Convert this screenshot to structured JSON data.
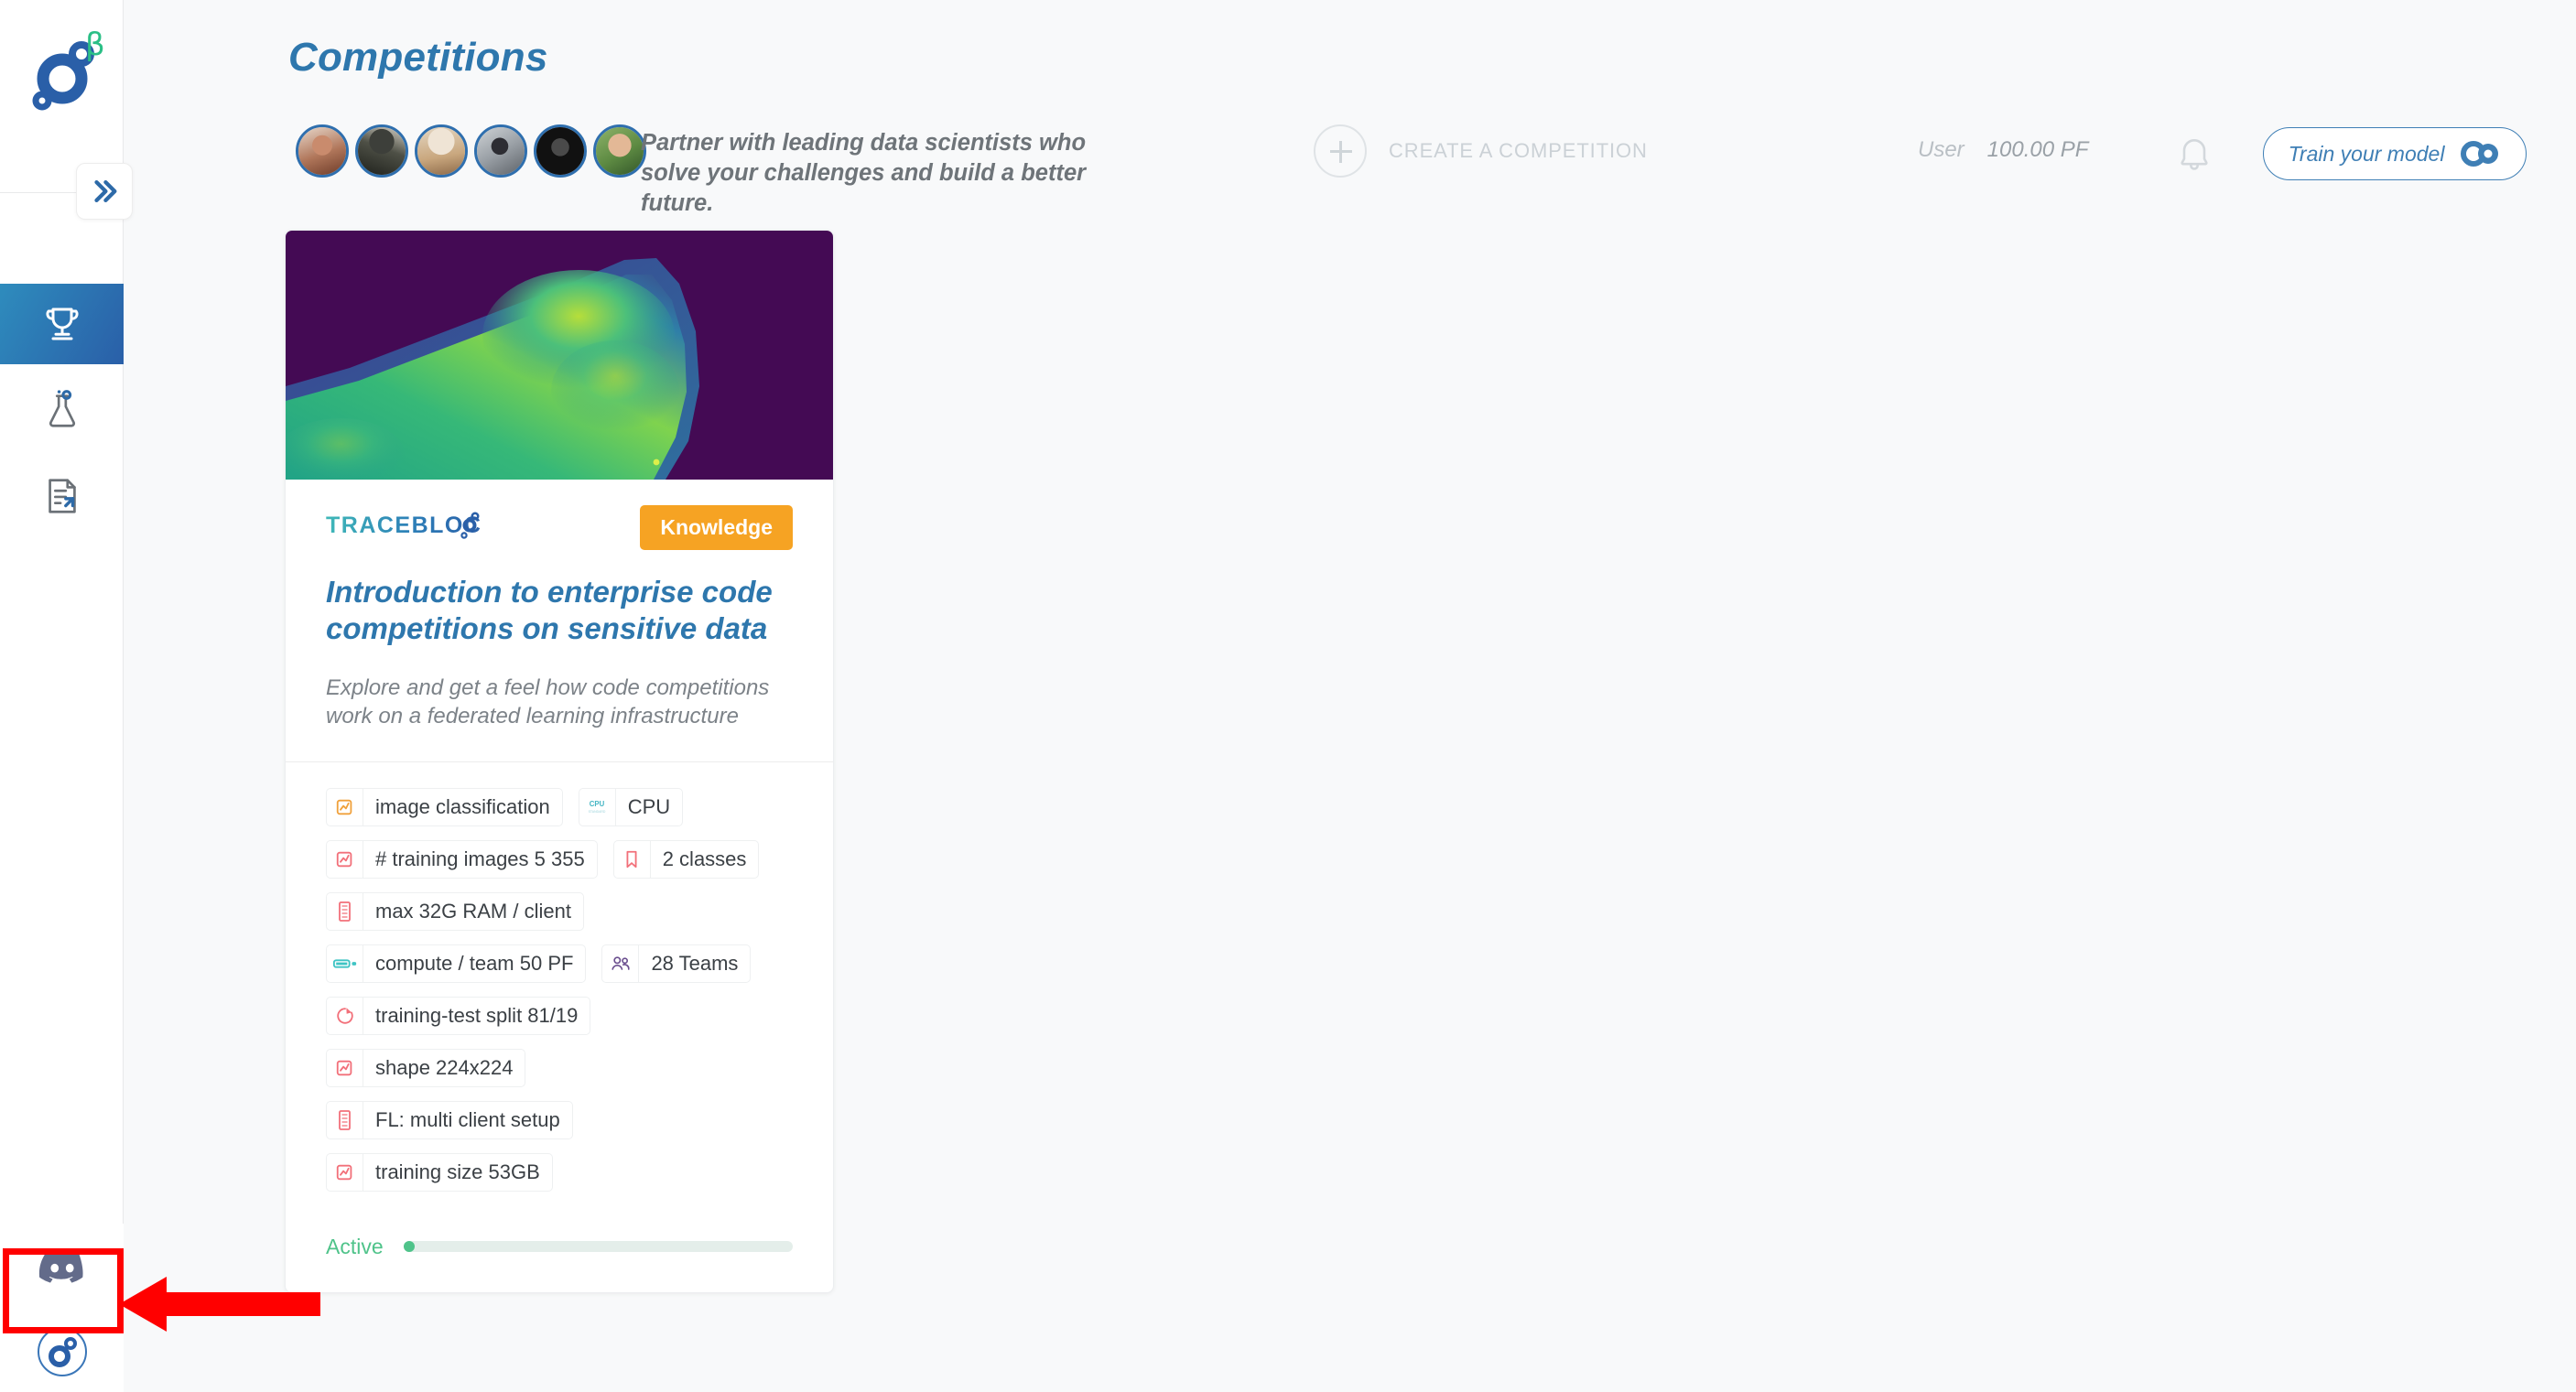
{
  "sidebar": {
    "logo_name": "tracebloc-logo",
    "beta_label": "β",
    "collapse_icon": "chevron-double-right-icon",
    "items": [
      {
        "name": "competitions",
        "icon": "trophy-icon",
        "active": true
      },
      {
        "name": "experiments",
        "icon": "flask-icon",
        "active": false
      },
      {
        "name": "documentation",
        "icon": "document-export-icon",
        "active": false
      }
    ],
    "bottom": [
      {
        "name": "discord",
        "icon": "discord-icon"
      },
      {
        "name": "user-avatar",
        "icon": "tracebloc-circle-icon"
      }
    ]
  },
  "header": {
    "title": "Competitions",
    "tagline": "Partner with leading data scientists who solve your challenges and build a better future.",
    "avatars_count": 6,
    "create_competition": {
      "label": "CREATE A COMPETITION",
      "icon": "plus-circle-icon"
    },
    "user": {
      "label": "User",
      "balance": "100.00 PF"
    },
    "notifications_icon": "bell-icon",
    "train_button": {
      "label": "Train your model",
      "icon": "colab-icon"
    }
  },
  "card": {
    "image_alt": "mammogram-heatmap-viridis",
    "brand": "TRACEBLOC",
    "badge": "Knowledge",
    "title": "Introduction to enterprise code competitions on sensitive data",
    "description": "Explore and get a feel how code competitions work on a federated learning infrastructure",
    "tags": [
      {
        "icon": "chart-orange-icon",
        "label": "image classification"
      },
      {
        "icon": "cpu-icon",
        "label": "CPU"
      },
      {
        "icon": "chart-red-icon",
        "label": "# training images 5 355"
      },
      {
        "icon": "bookmark-icon",
        "label": "2 classes"
      },
      {
        "icon": "ram-icon",
        "label": "max 32G RAM / client"
      },
      {
        "icon": "battery-icon",
        "label": "compute / team 50 PF"
      },
      {
        "icon": "people-icon",
        "label": "28 Teams"
      },
      {
        "icon": "pie-split-icon",
        "label": "training-test split 81/19"
      },
      {
        "icon": "chart-red-icon",
        "label": "shape 224x224"
      },
      {
        "icon": "ram-icon",
        "label": "FL: multi client setup"
      },
      {
        "icon": "chart-red-icon",
        "label": "training size 53GB"
      }
    ],
    "status": {
      "label": "Active",
      "progress_percent": 1,
      "color": "#4fc38a"
    }
  },
  "annotation": {
    "highlight_target": "discord-icon",
    "box_color": "#ff0000",
    "arrow_color": "#ff0000"
  },
  "colors": {
    "brand_blue": "#2e77ad",
    "accent_orange": "#f6a323",
    "status_green": "#4fc38a",
    "beta_green": "#2bbf86"
  }
}
